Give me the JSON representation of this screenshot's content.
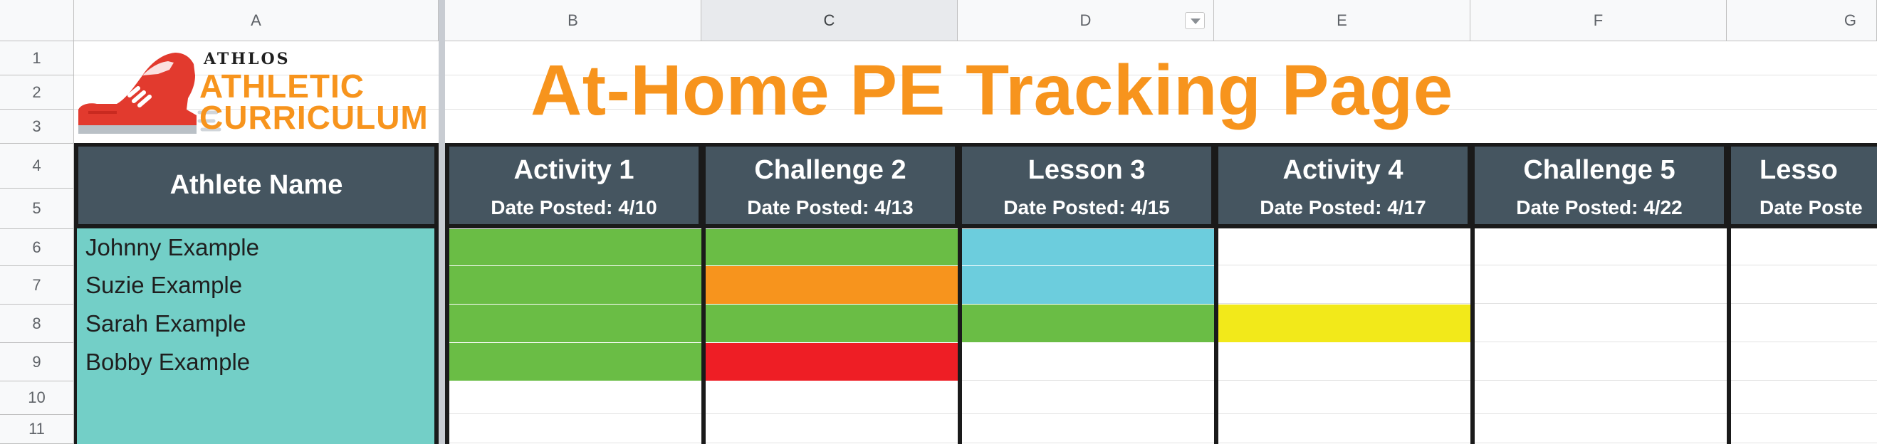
{
  "columns": [
    "A",
    "B",
    "C",
    "D",
    "E",
    "F",
    "G"
  ],
  "rows": [
    "1",
    "2",
    "3",
    "4",
    "5",
    "6",
    "7",
    "8",
    "9",
    "10",
    "11"
  ],
  "logo": {
    "small": "ATHLOS",
    "line1": "ATHLETIC",
    "line2": "CURRICULUM"
  },
  "title": "At-Home PE Tracking Page",
  "name_header": "Athlete Name",
  "assignments": [
    {
      "title": "Activity 1",
      "date": "Date Posted: 4/10"
    },
    {
      "title": "Challenge 2",
      "date": "Date Posted: 4/13"
    },
    {
      "title": "Lesson 3",
      "date": "Date Posted: 4/15"
    },
    {
      "title": "Activity 4",
      "date": "Date Posted: 4/17"
    },
    {
      "title": "Challenge 5",
      "date": "Date Posted: 4/22"
    },
    {
      "title": "Lesso",
      "date": "Date Poste"
    }
  ],
  "athletes": [
    "Johnny Example",
    "Suzie Example",
    "Sarah Example",
    "Bobby Example",
    "",
    ""
  ],
  "status_colors": {
    "green": "#6abd45",
    "orange": "#f7941d",
    "blue": "#6ccddd",
    "yellow": "#f2e91a",
    "red": "#ee1e25",
    "white": "#ffffff"
  },
  "status_grid": [
    [
      "green",
      "green",
      "blue",
      "white",
      "white",
      "white"
    ],
    [
      "green",
      "orange",
      "blue",
      "white",
      "white",
      "white"
    ],
    [
      "green",
      "green",
      "green",
      "yellow",
      "white",
      "white"
    ],
    [
      "green",
      "red",
      "white",
      "white",
      "white",
      "white"
    ],
    [
      "white",
      "white",
      "white",
      "white",
      "white",
      "white"
    ],
    [
      "white",
      "white",
      "white",
      "white",
      "white",
      "white"
    ]
  ]
}
